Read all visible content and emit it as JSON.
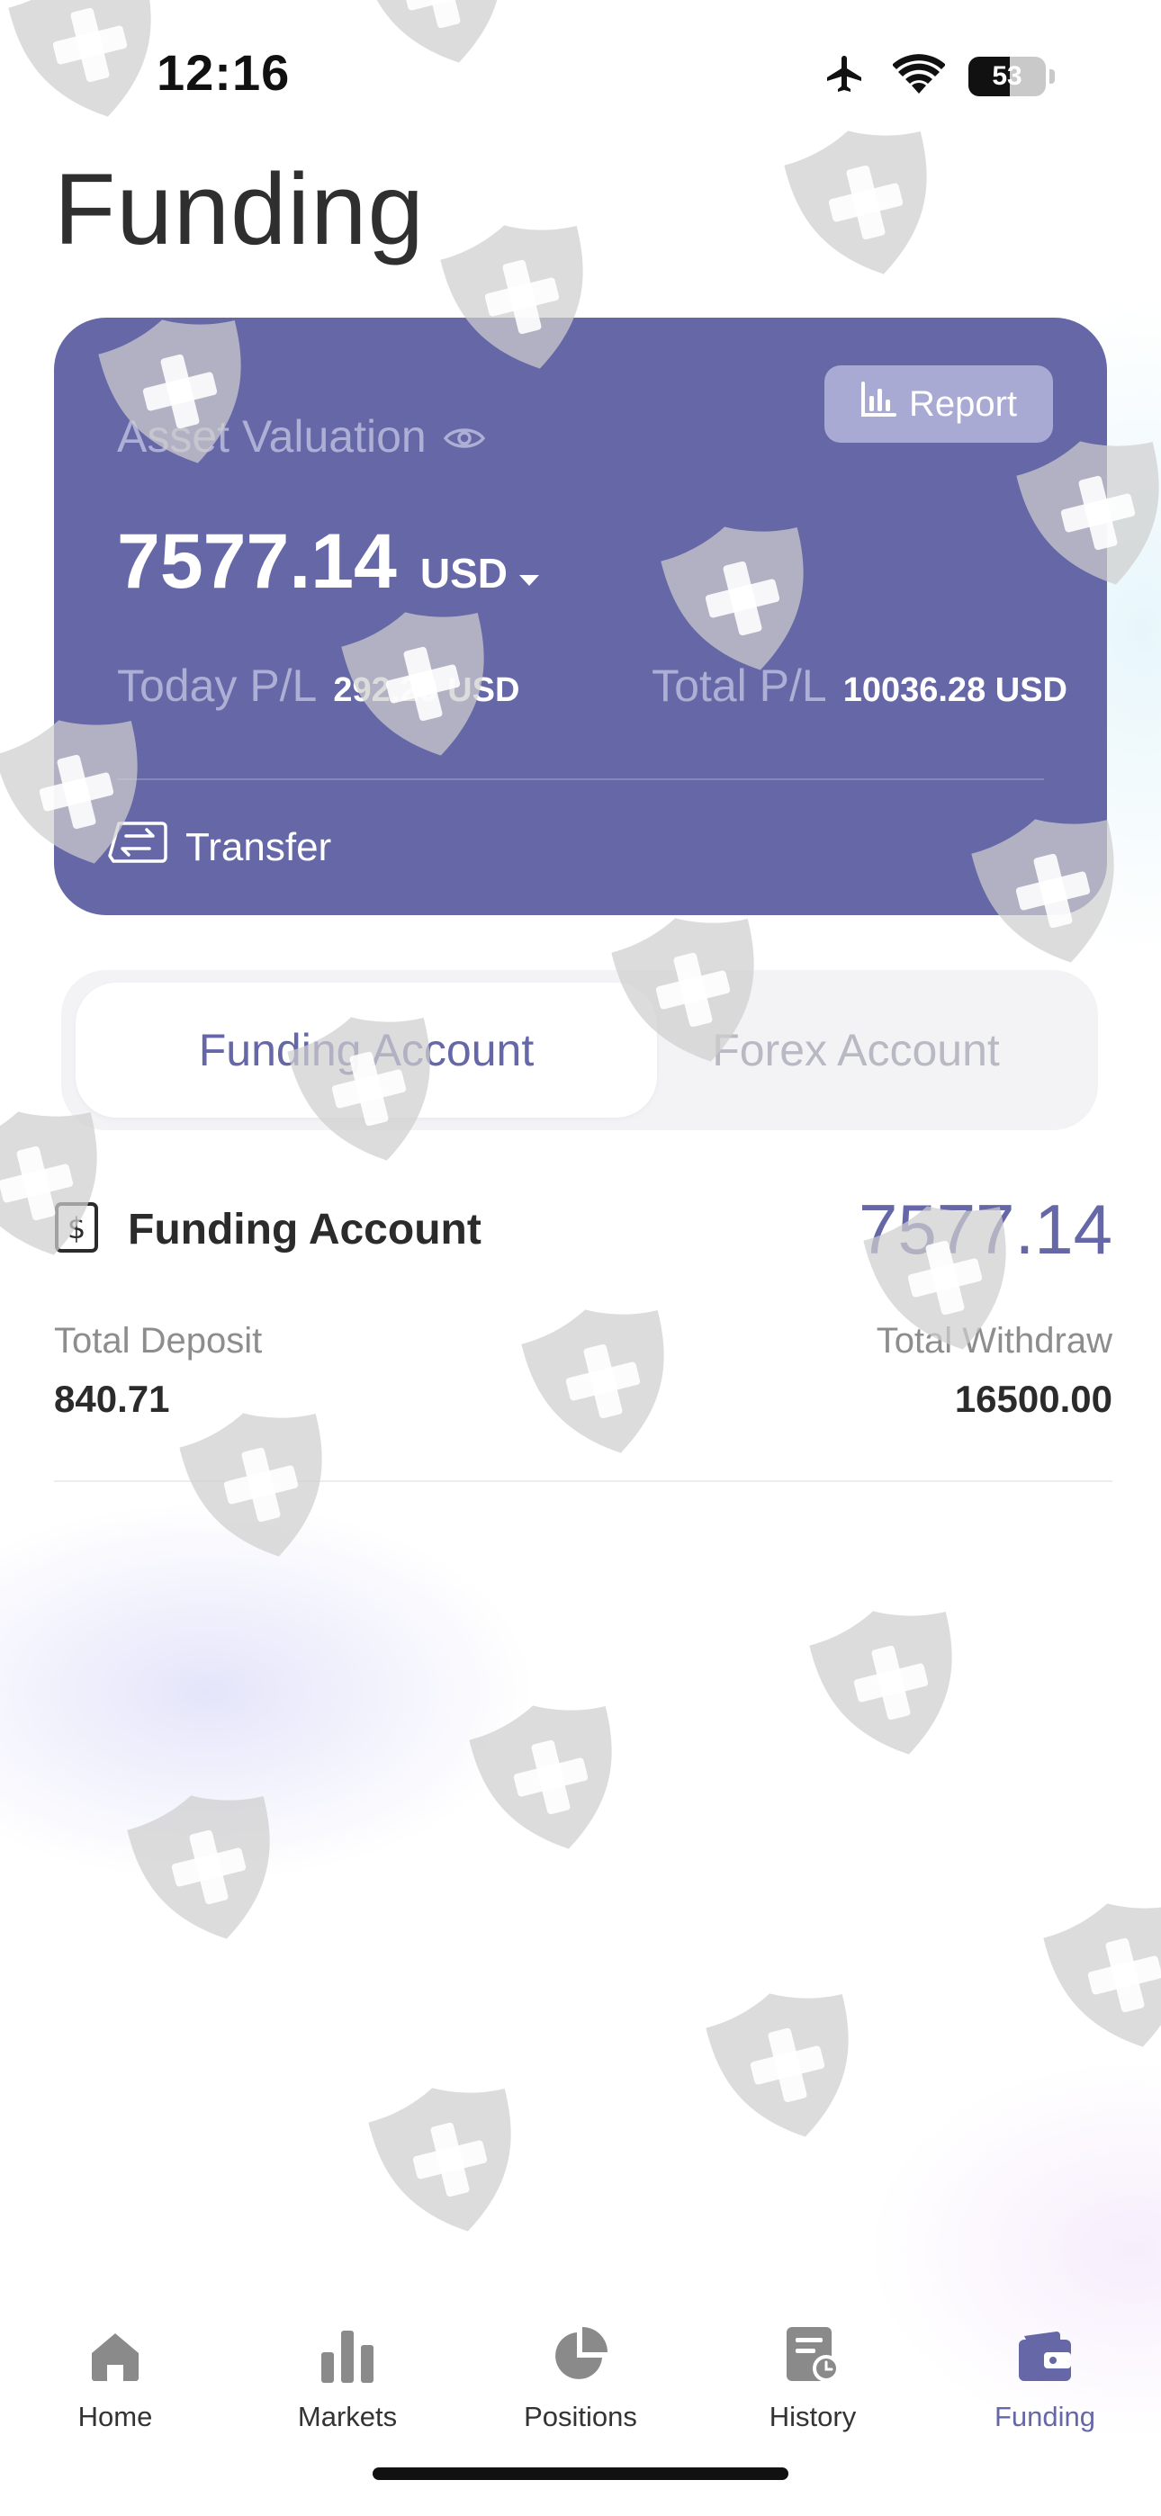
{
  "status_bar": {
    "time": "12:16",
    "battery_level": "53",
    "battery_fraction": 0.53
  },
  "page": {
    "title": "Funding"
  },
  "asset_card": {
    "report_label": "Report",
    "asset_label": "Asset Valuation",
    "asset_value": "7577.14",
    "currency": "USD",
    "today_pl_label": "Today P/L",
    "today_pl_value": "292.20 USD",
    "total_pl_label": "Total P/L",
    "total_pl_value": "10036.28 USD",
    "transfer_label": "Transfer"
  },
  "account_tabs": [
    {
      "label": "Funding Account",
      "active": true
    },
    {
      "label": "Forex Account",
      "active": false
    }
  ],
  "funding_account": {
    "name": "Funding Account",
    "balance": "7577.14",
    "total_deposit_label": "Total Deposit",
    "total_deposit": "840.71",
    "total_withdraw_label": "Total Withdraw",
    "total_withdraw": "16500.00"
  },
  "tab_bar": [
    {
      "label": "Home",
      "icon": "home-icon"
    },
    {
      "label": "Markets",
      "icon": "markets-icon"
    },
    {
      "label": "Positions",
      "icon": "positions-icon"
    },
    {
      "label": "History",
      "icon": "history-icon"
    },
    {
      "label": "Funding",
      "icon": "funding-icon",
      "active": true
    }
  ],
  "colors": {
    "accent": "#6567a7",
    "card_background": "#6567a7",
    "report_button": "#a9aad3",
    "inactive_text": "#b9b9c4",
    "watermark": "#d6d6d6"
  }
}
